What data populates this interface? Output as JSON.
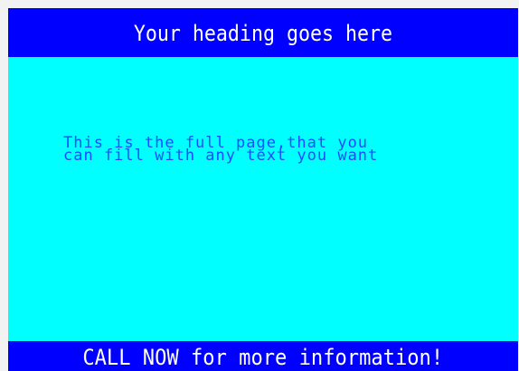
{
  "header": {
    "heading": "Your heading goes here"
  },
  "content": {
    "line_1": "This is the full page,that you",
    "line_2": "can fill with any text you want"
  },
  "footer": {
    "call_to_action": "CALL NOW for more information!"
  },
  "colors": {
    "bar_background": "#0000ff",
    "content_background": "#00ffff",
    "body_text": "#1a4bff",
    "bar_text": "#ffffff"
  }
}
